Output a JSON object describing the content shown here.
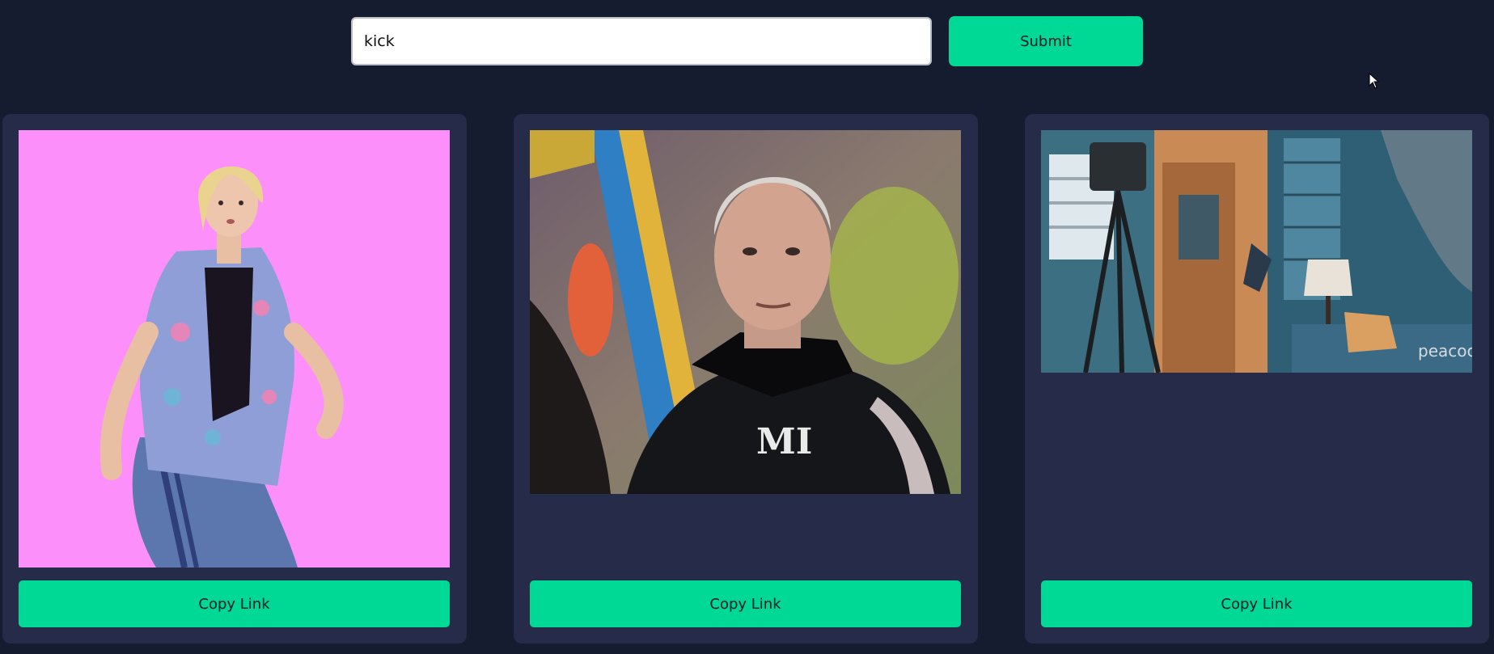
{
  "search": {
    "value": "kick",
    "submit_label": "Submit"
  },
  "results": [
    {
      "copy_label": "Copy Link"
    },
    {
      "copy_label": "Copy Link"
    },
    {
      "copy_label": "Copy Link",
      "watermark": "peacock"
    }
  ],
  "colors": {
    "background": "#161c2f",
    "card": "#262b4a",
    "accent": "#00d896"
  }
}
